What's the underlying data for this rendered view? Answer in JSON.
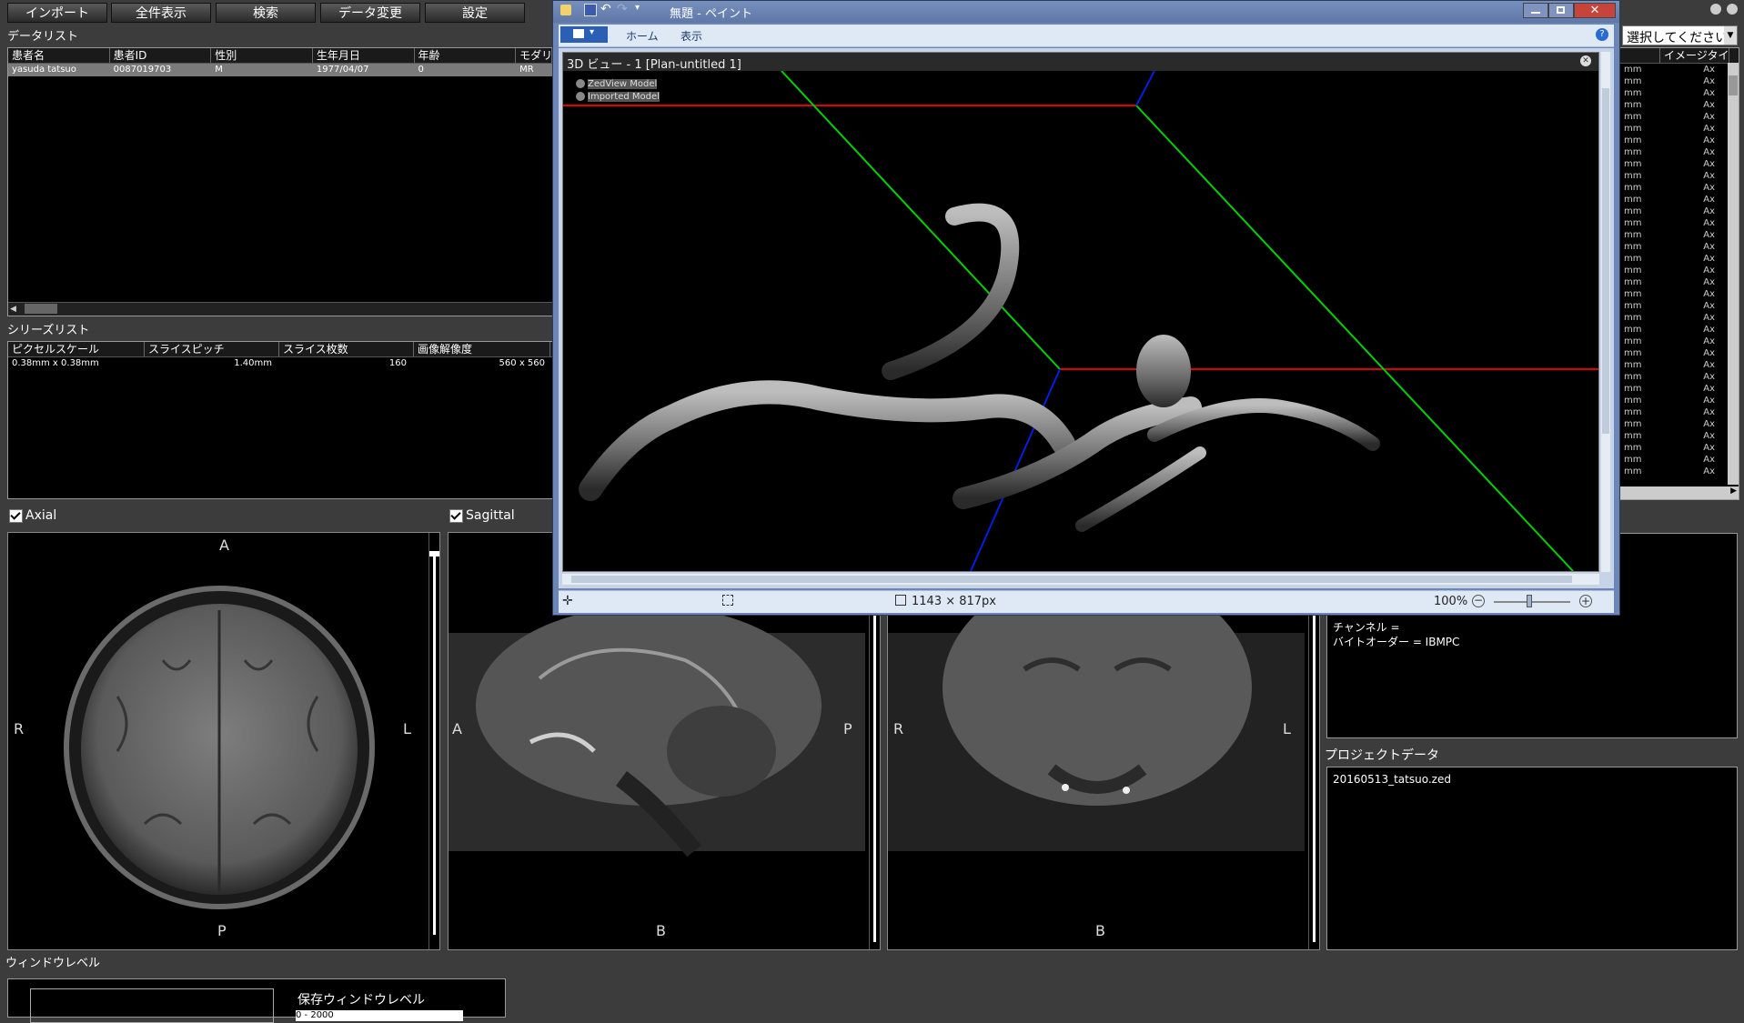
{
  "toolbar": {
    "import": "インポート",
    "show_all": "全件表示",
    "search": "検索",
    "data_change": "データ変更",
    "settings": "設定"
  },
  "data_list": {
    "title": "データリスト",
    "columns": [
      "患者名",
      "患者ID",
      "性別",
      "生年月日",
      "年齢",
      "モダリ"
    ],
    "rows": [
      [
        "yasuda tatsuo",
        "0087019703",
        "M",
        "1977/04/07",
        "0",
        "MR"
      ]
    ]
  },
  "series_list": {
    "title": "シリーズリスト",
    "columns": [
      "ピクセルスケール",
      "スライスピッチ",
      "スライス枚数",
      "画像解像度"
    ],
    "rows": [
      [
        "0.38mm x 0.38mm",
        "1.40mm",
        "160",
        "560 x 560"
      ]
    ]
  },
  "right_panel": {
    "select_placeholder": "選択してください",
    "image_type_header": "イメージタイプ",
    "row_unit": "mm",
    "row_type": "Ax",
    "info_lines": [
      "チャンネル =",
      "バイトオーダー = IBMPC"
    ],
    "project_title": "プロジェクトデータ",
    "project_items": [
      "20160513_tatsuo.zed"
    ]
  },
  "viewers": {
    "axial": {
      "label": "Axial",
      "top": "A",
      "bottom": "P",
      "left": "R",
      "right": "L"
    },
    "sagittal": {
      "label": "Sagittal",
      "left": "A",
      "right": "P",
      "bottom": "B"
    },
    "coronal": {
      "left": "R",
      "right": "L",
      "bottom": "B"
    }
  },
  "window_level": {
    "title": "ウィンドウレベル",
    "saved_label": "保存ウィンドウレベル",
    "field_value": "0 - 2000"
  },
  "paint": {
    "title": "無題 - ペイント",
    "ribbon_tabs": [
      "ホーム",
      "表示"
    ],
    "inner_title": "3D ビュー - 1 [Plan-untitled 1]",
    "layers": [
      "ZedView Model",
      "Imported Model"
    ],
    "status_size": "1143 × 817px",
    "zoom": "100%"
  }
}
